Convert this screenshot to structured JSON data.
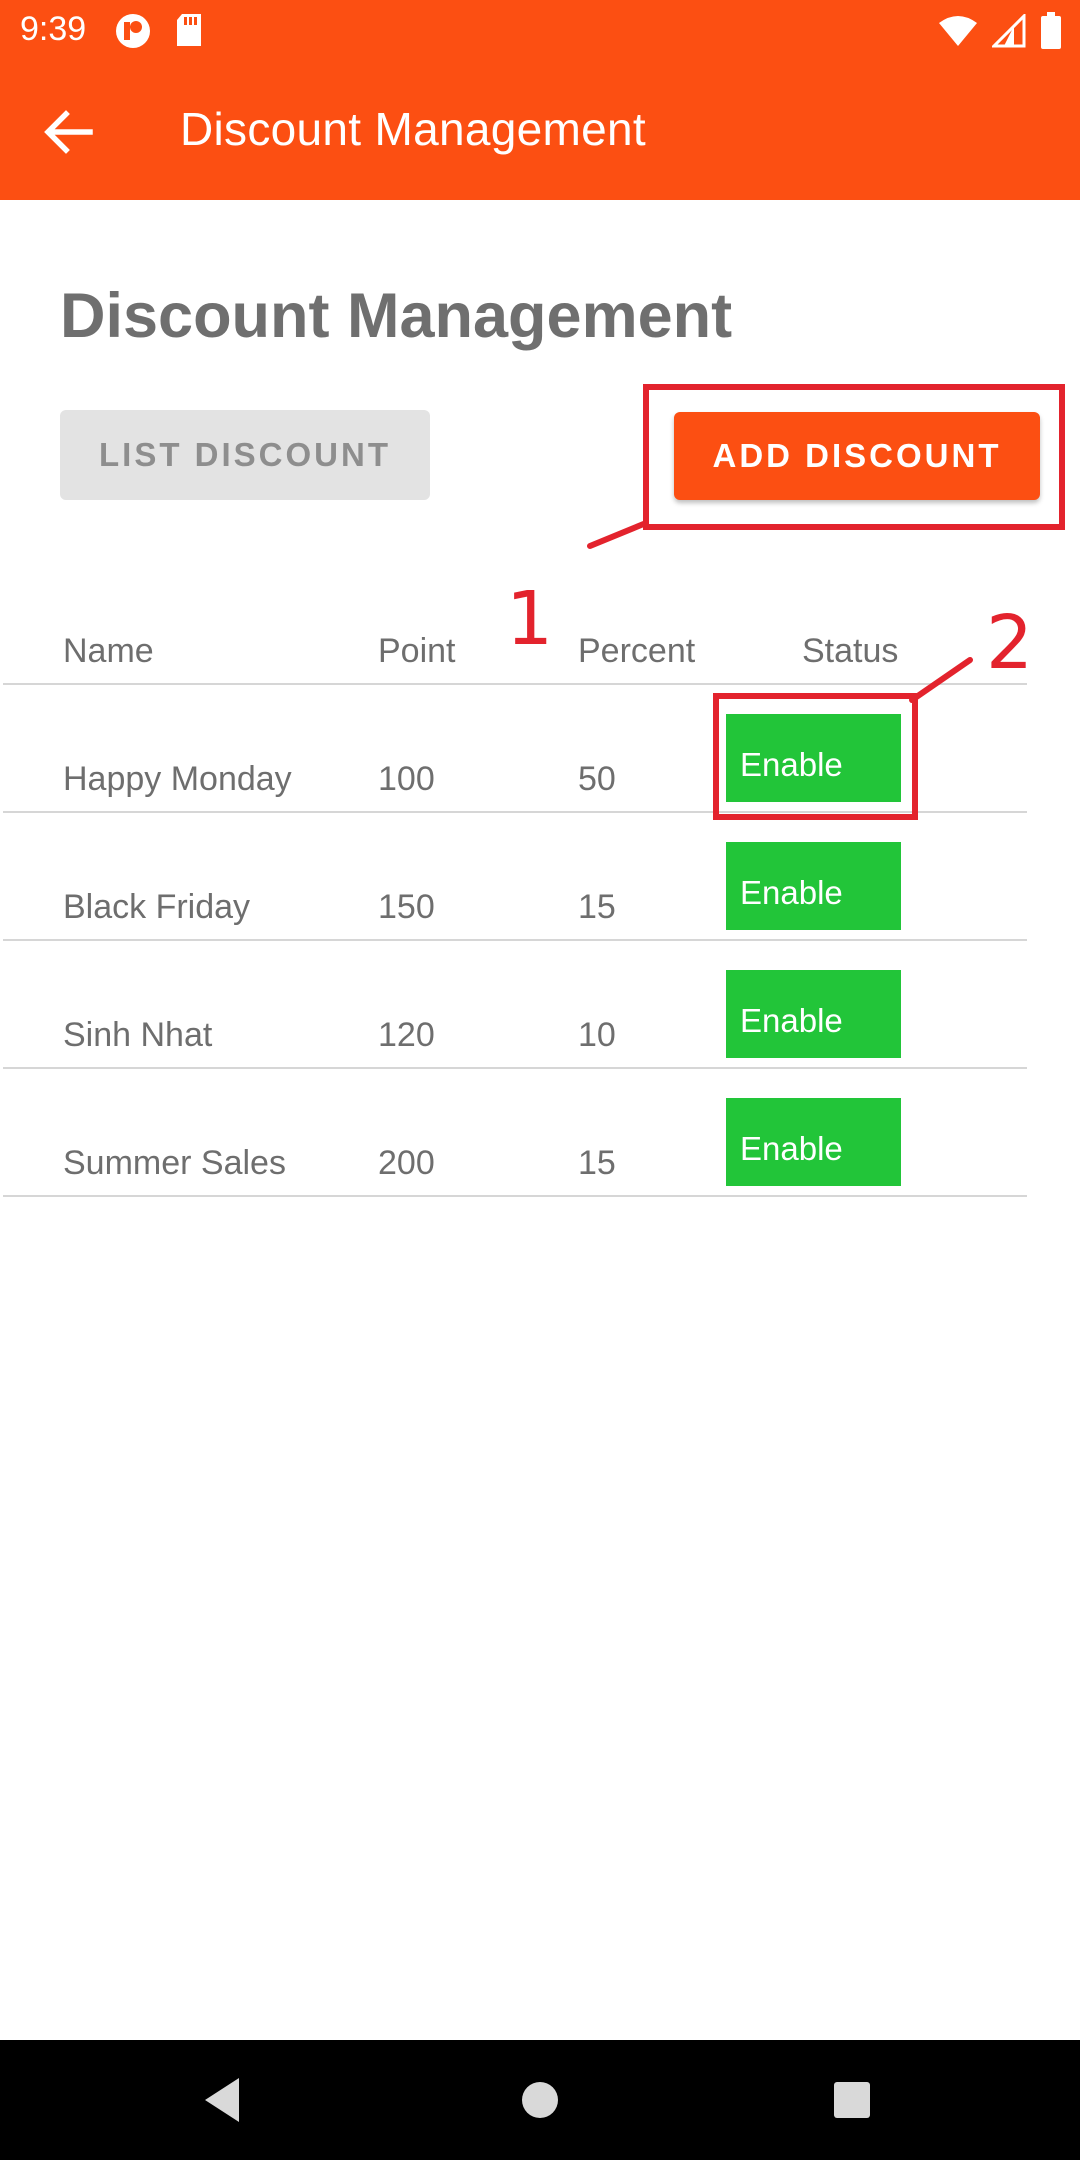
{
  "status_bar": {
    "time": "9:39"
  },
  "app_bar": {
    "title": "Discount Management"
  },
  "page": {
    "heading": "Discount Management"
  },
  "buttons": {
    "list": "LIST DISCOUNT",
    "add": "ADD DISCOUNT"
  },
  "table": {
    "headers": [
      "Name",
      "Point",
      "Percent",
      "Status"
    ],
    "rows": [
      {
        "name": "Happy Monday",
        "point": "100",
        "percent": "50",
        "status": "Enable"
      },
      {
        "name": "Black Friday",
        "point": "150",
        "percent": "15",
        "status": "Enable"
      },
      {
        "name": "Sinh Nhat",
        "point": "120",
        "percent": "10",
        "status": "Enable"
      },
      {
        "name": "Summer Sales",
        "point": "200",
        "percent": "15",
        "status": "Enable"
      }
    ]
  },
  "annotations": [
    "1",
    "2"
  ],
  "colors": {
    "primary": "#fc4f12",
    "enabled": "#22c539",
    "annotation": "#e3232d",
    "text": "#6e6e6e"
  }
}
